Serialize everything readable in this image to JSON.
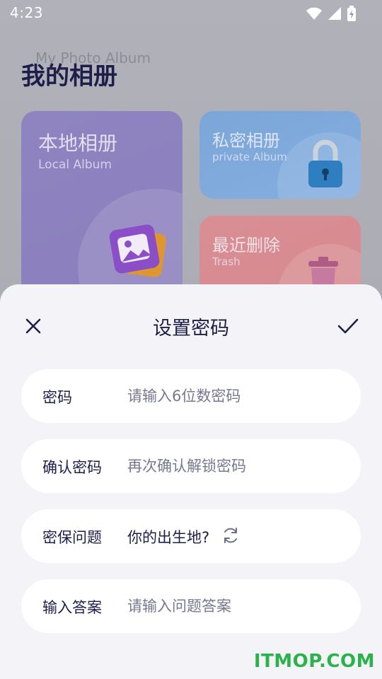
{
  "status_bar": {
    "time": "4:23"
  },
  "app": {
    "subtitle": "My Photo Album",
    "title": "我的相册",
    "cards": {
      "local": {
        "title": "本地相册",
        "subtitle": "Local Album"
      },
      "private": {
        "title": "私密相册",
        "subtitle": "private Album"
      },
      "trash": {
        "title": "最近删除",
        "subtitle": "Trash"
      }
    }
  },
  "sheet": {
    "title": "设置密码",
    "fields": [
      {
        "label": "密码",
        "placeholder": "请输入6位数密码"
      },
      {
        "label": "确认密码",
        "placeholder": "再次确认解锁密码"
      },
      {
        "label": "密保问题",
        "value": "你的出生地?"
      },
      {
        "label": "输入答案",
        "placeholder": "请输入问题答案"
      }
    ]
  },
  "watermark": "ITMOP.COM",
  "colors": {
    "accent": "#1f1e4a",
    "sheet_bg": "#f4f4f8",
    "field_bg": "#ffffff",
    "placeholder": "#77778f",
    "watermark": "#2bb24c"
  },
  "icons": [
    "wifi-icon",
    "signal-icon",
    "battery-icon",
    "close-icon",
    "check-icon",
    "refresh-icon",
    "photos-icon",
    "lock-icon",
    "trash-can-icon"
  ]
}
